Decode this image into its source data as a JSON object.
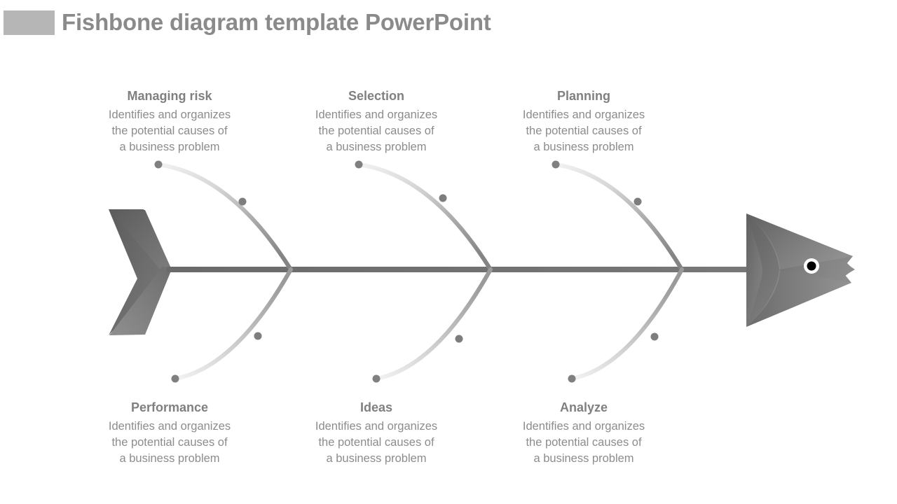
{
  "header": {
    "title": "Fishbone diagram template PowerPoint",
    "accent_color": "#b6b6b6",
    "title_color": "#8a8a8a"
  },
  "diagram": {
    "type": "fishbone",
    "spine_color": "#6e6e6e",
    "head_color_dark": "#636363",
    "head_color_light": "#8d8d8d",
    "tail_color_dark": "#5f5f5f",
    "tail_color_light": "#8f8f8f",
    "rib_color_dark": "#8a8a8a",
    "rib_color_light": "#ededed",
    "dot_color": "#808080",
    "eye_outer_color": "#ffffff",
    "eye_inner_color": "#000000",
    "branches_top": [
      {
        "title": "Managing risk",
        "desc_lines": [
          "Identifies and organizes",
          "the potential causes of",
          "a business problem"
        ]
      },
      {
        "title": "Selection",
        "desc_lines": [
          "Identifies and organizes",
          "the potential causes of",
          "a business problem"
        ]
      },
      {
        "title": "Planning",
        "desc_lines": [
          "Identifies and organizes",
          "the potential causes of",
          "a business problem"
        ]
      }
    ],
    "branches_bottom": [
      {
        "title": "Performance",
        "desc_lines": [
          "Identifies and organizes",
          "the potential causes of",
          "a business problem"
        ]
      },
      {
        "title": "Ideas",
        "desc_lines": [
          "Identifies and organizes",
          "the potential causes of",
          "a business problem"
        ]
      },
      {
        "title": "Analyze",
        "desc_lines": [
          "Identifies and organizes",
          "the potential causes of",
          "a business problem"
        ]
      }
    ]
  }
}
